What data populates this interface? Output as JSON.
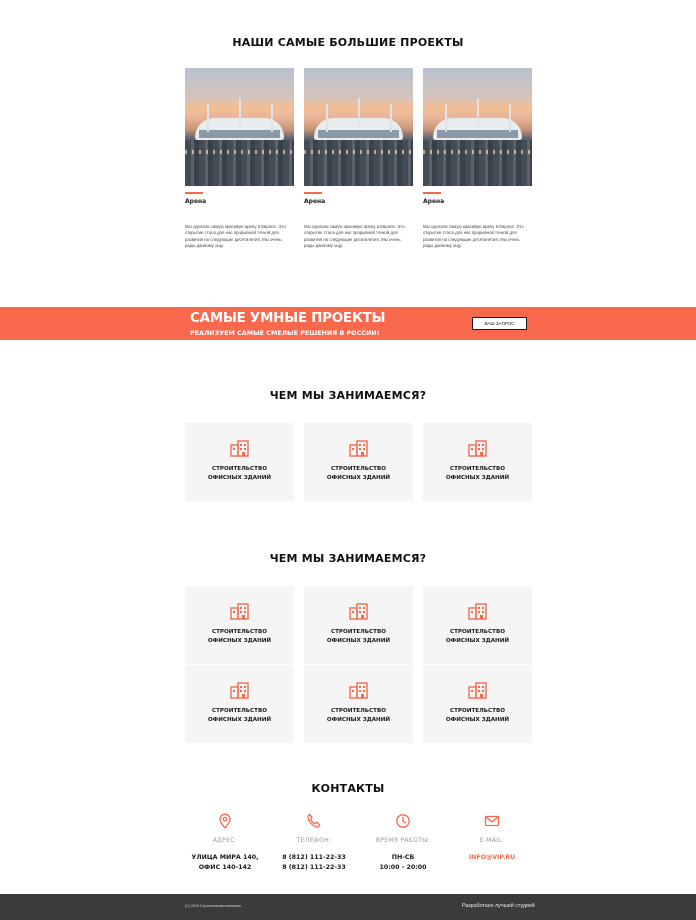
{
  "projects": {
    "title": "НАШИ САМЫЕ БОЛЬШИЕ ПРОЕКТЫ",
    "items": [
      {
        "name": "Арена",
        "desc": "Мы сделали самую красивую арену в Европе. Это открытие стало для нас прорывной точкой для развития на следующие десятилетия. Мы очень рады данному ощу."
      },
      {
        "name": "Арена",
        "desc": "Мы сделали самую красивую арену в Европе. Это открытие стало для нас прорывной точкой для развития на следующие десятилетия. Мы очень рады данному ощу."
      },
      {
        "name": "Арена",
        "desc": "Мы сделали самую красивую арену в Европе. Это открытие стало для нас прорывной точкой для развития на следующие десятилетия. Мы очень рады данному ощу."
      }
    ]
  },
  "banner": {
    "title": "САМЫЕ УМНЫЕ ПРОЕКТЫ",
    "subtitle": "РЕАЛИЗУЕМ САМЫЕ СМЕЛЫЕ РЕШЕНИЯ В РОССИИ!",
    "button": "ВАШ ЗАПРОС",
    "color": "#f8684d"
  },
  "services_1": {
    "title": "ЧЕМ МЫ ЗАНИМАЕМСЯ?",
    "items": [
      {
        "line1": "СТРОИТЕЛЬСТВО",
        "line2": "ОФИСНЫХ ЗДАНИЙ",
        "icon": "office-building-icon"
      },
      {
        "line1": "СТРОИТЕЛЬСТВО",
        "line2": "ОФИСНЫХ ЗДАНИЙ",
        "icon": "office-building-icon"
      },
      {
        "line1": "СТРОИТЕЛЬСТВО",
        "line2": "ОФИСНЫХ ЗДАНИЙ",
        "icon": "office-building-icon"
      }
    ]
  },
  "services_2": {
    "title": "ЧЕМ МЫ ЗАНИМАЕМСЯ?",
    "items": [
      {
        "line1": "СТРОИТЕЛЬСТВО",
        "line2": "ОФИСНЫХ ЗДАНИЙ",
        "icon": "office-building-icon"
      },
      {
        "line1": "СТРОИТЕЛЬСТВО",
        "line2": "ОФИСНЫХ ЗДАНИЙ",
        "icon": "office-building-icon"
      },
      {
        "line1": "СТРОИТЕЛЬСТВО",
        "line2": "ОФИСНЫХ ЗДАНИЙ",
        "icon": "office-building-icon"
      },
      {
        "line1": "СТРОИТЕЛЬСТВО",
        "line2": "ОФИСНЫХ ЗДАНИЙ",
        "icon": "office-building-icon"
      },
      {
        "line1": "СТРОИТЕЛЬСТВО",
        "line2": "ОФИСНЫХ ЗДАНИЙ",
        "icon": "office-building-icon"
      },
      {
        "line1": "СТРОИТЕЛЬСТВО",
        "line2": "ОФИСНЫХ ЗДАНИЙ",
        "icon": "office-building-icon"
      }
    ]
  },
  "contacts": {
    "title": "КОНТАКТЫ",
    "address": {
      "label": "АДРЕС:",
      "line1": "УЛИЦА МИРА 140,",
      "line2": "ОФИС 140-142",
      "icon": "map-pin-icon"
    },
    "phone": {
      "label": "ТЕЛЕФОН:",
      "line1": "8 (812) 111-22-33",
      "line2": "8 (812) 111-22-33",
      "icon": "phone-icon"
    },
    "hours": {
      "label": "ВРЕМЯ РАБОТЫ:",
      "line1": "ПН-СБ",
      "line2": "10:00 - 20:00",
      "icon": "clock-icon"
    },
    "email": {
      "label": "E-MAIL:",
      "value": "INFO@VIP.RU",
      "icon": "mail-icon"
    }
  },
  "footer": {
    "copyright": "(С) 2019 Строительная компания",
    "developer": "Разработано лучшей студией"
  },
  "colors": {
    "accent": "#f26a4b",
    "card_bg": "#f5f5f5",
    "footer_bg": "#3b3b3d"
  }
}
